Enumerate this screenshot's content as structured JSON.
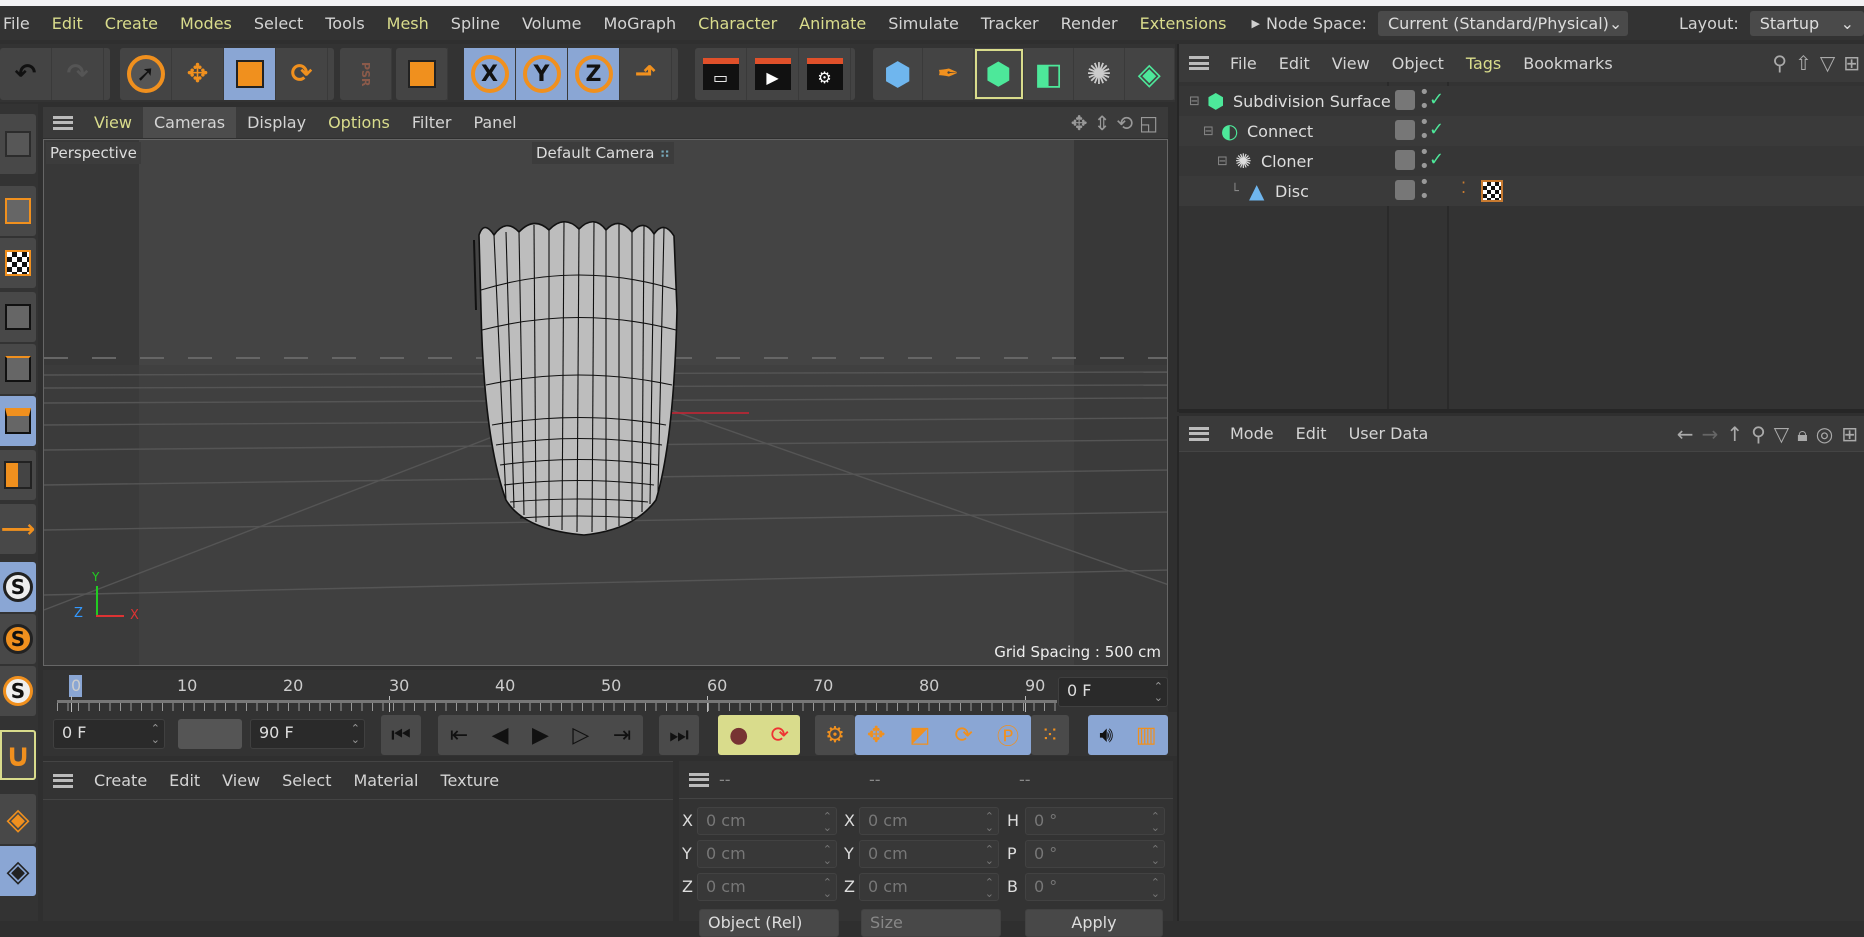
{
  "menubar": {
    "items": [
      {
        "label": "File",
        "y": false
      },
      {
        "label": "Edit",
        "y": true
      },
      {
        "label": "Create",
        "y": true
      },
      {
        "label": "Modes",
        "y": true
      },
      {
        "label": "Select",
        "y": false
      },
      {
        "label": "Tools",
        "y": false
      },
      {
        "label": "Mesh",
        "y": true
      },
      {
        "label": "Spline",
        "y": false
      },
      {
        "label": "Volume",
        "y": false
      },
      {
        "label": "MoGraph",
        "y": false
      },
      {
        "label": "Character",
        "y": true
      },
      {
        "label": "Animate",
        "y": true
      },
      {
        "label": "Simulate",
        "y": false
      },
      {
        "label": "Tracker",
        "y": false
      },
      {
        "label": "Render",
        "y": false
      },
      {
        "label": "Extensions",
        "y": true
      }
    ],
    "node_space_label": "Node Space:",
    "node_space_value": "Current (Standard/Physical)",
    "layout_label": "Layout:",
    "layout_value": "Startup"
  },
  "toolbar": {
    "x": "X",
    "y": "Y",
    "z": "Z",
    "psr": "PSR"
  },
  "viewport": {
    "menu": [
      "View",
      "Cameras",
      "Display",
      "Options",
      "Filter",
      "Panel"
    ],
    "view_name": "Perspective",
    "camera": "Default Camera",
    "grid_spacing": "Grid Spacing : 500 cm",
    "axis": {
      "x": "X",
      "y": "Y",
      "z": "Z"
    }
  },
  "timeline": {
    "ticks": [
      "0",
      "10",
      "20",
      "30",
      "40",
      "50",
      "60",
      "70",
      "80",
      "90"
    ],
    "current_frame": "0 F",
    "playhead_frame": 0
  },
  "transport": {
    "start": "0 F",
    "end": "90 F"
  },
  "material": {
    "menu": [
      "Create",
      "Edit",
      "View",
      "Select",
      "Material",
      "Texture"
    ]
  },
  "coords": {
    "headers": [
      "--",
      "--",
      "--"
    ],
    "rows": [
      {
        "l1": "X",
        "v1": "0 cm",
        "l2": "X",
        "v2": "0 cm",
        "l3": "H",
        "v3": "0 °"
      },
      {
        "l1": "Y",
        "v1": "0 cm",
        "l2": "Y",
        "v2": "0 cm",
        "l3": "P",
        "v3": "0 °"
      },
      {
        "l1": "Z",
        "v1": "0 cm",
        "l2": "Z",
        "v2": "0 cm",
        "l3": "B",
        "v3": "0 °"
      }
    ],
    "mode": "Object (Rel)",
    "size": "Size",
    "apply": "Apply"
  },
  "objects": {
    "menu": [
      "File",
      "Edit",
      "View",
      "Object",
      "Tags",
      "Bookmarks"
    ],
    "items": [
      {
        "name": "Subdivision Surface",
        "enabled": true
      },
      {
        "name": "Connect",
        "enabled": true
      },
      {
        "name": "Cloner",
        "enabled": true
      },
      {
        "name": "Disc",
        "enabled": false
      }
    ]
  },
  "attributes": {
    "menu": [
      "Mode",
      "Edit",
      "User Data"
    ]
  },
  "colors": {
    "accent": "#f0901e",
    "selected": "#8aa6d4",
    "check": "#4de89a"
  }
}
